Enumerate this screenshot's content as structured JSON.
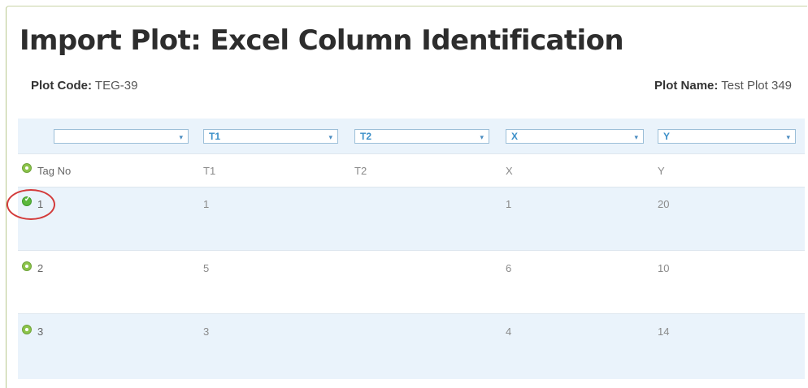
{
  "page": {
    "title": "Import Plot: Excel Column Identification",
    "plot_code_label": "Plot Code:",
    "plot_code": "TEG-39",
    "plot_name_label": "Plot Name:",
    "plot_name": "Test Plot 349"
  },
  "column_selects": [
    {
      "value": "",
      "caret": "▾"
    },
    {
      "value": "T1",
      "caret": "▾"
    },
    {
      "value": "T2",
      "caret": "▾"
    },
    {
      "value": "X",
      "caret": "▾"
    },
    {
      "value": "Y",
      "caret": "▾"
    }
  ],
  "rows": [
    {
      "selected": false,
      "cells": [
        "Tag No",
        "T1",
        "T2",
        "X",
        "Y"
      ]
    },
    {
      "selected": true,
      "cells": [
        "1",
        "1",
        "",
        "1",
        "20"
      ]
    },
    {
      "selected": false,
      "cells": [
        "2",
        "5",
        "",
        "6",
        "10"
      ]
    },
    {
      "selected": false,
      "cells": [
        "3",
        "3",
        "",
        "4",
        "14"
      ]
    }
  ],
  "colors": {
    "header_row_bg": "#eaf3fb",
    "radio_green": "#8cc44a",
    "highlight_ring": "#d33a3a"
  }
}
